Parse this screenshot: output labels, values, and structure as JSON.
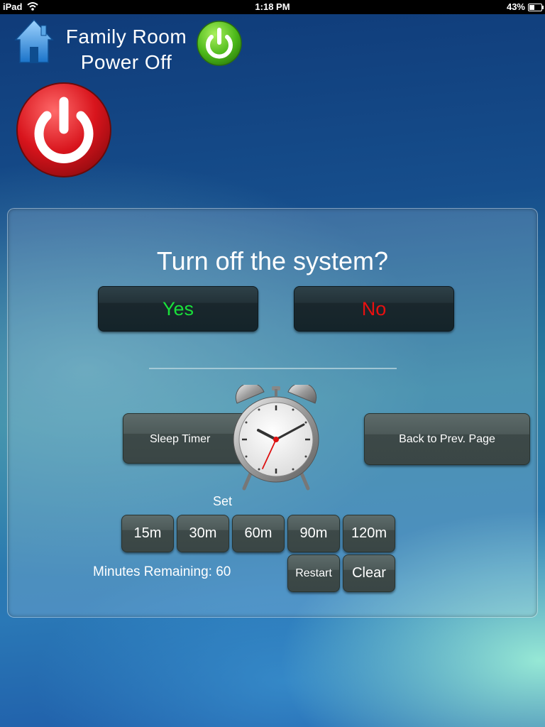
{
  "status_bar": {
    "carrier": "iPad",
    "time": "1:18 PM",
    "battery": "43%",
    "battery_level": 0.43
  },
  "header": {
    "title_line1": "Family Room",
    "title_line2": "Power Off"
  },
  "dialog": {
    "question": "Turn off the system?",
    "yes_label": "Yes",
    "no_label": "No"
  },
  "timer": {
    "sleep_timer_label": "Sleep Timer",
    "back_label": "Back to Prev. Page",
    "set_label": "Set",
    "presets": [
      "15m",
      "30m",
      "60m",
      "90m",
      "120m"
    ],
    "restart_label": "Restart",
    "clear_label": "Clear",
    "remaining_text": "Minutes Remaining: 60"
  },
  "colors": {
    "yes": "#19e03a",
    "no": "#e81010",
    "power_green": "#4cb81a",
    "power_red": "#d8141c"
  }
}
